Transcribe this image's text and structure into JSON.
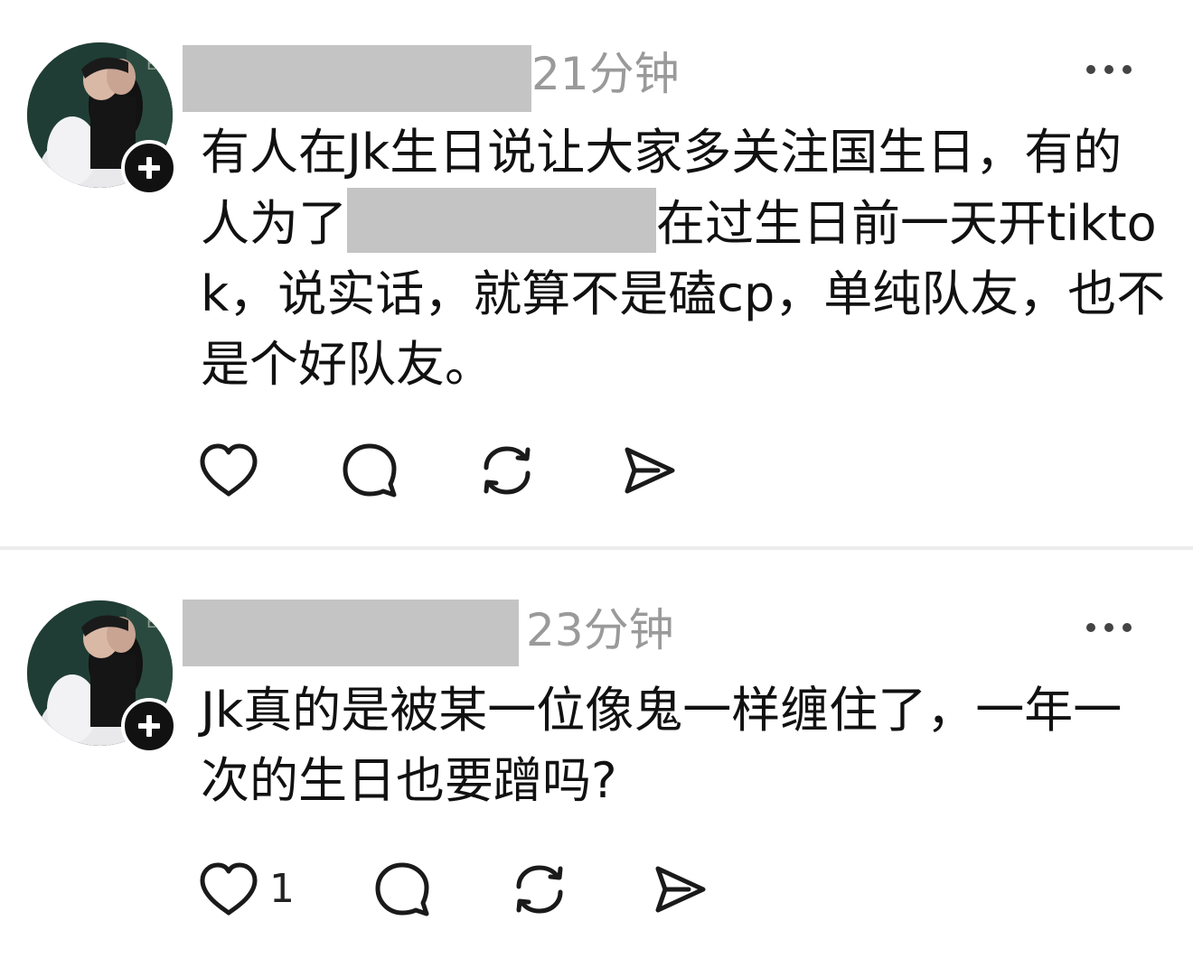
{
  "posts": [
    {
      "timestamp": "21分钟",
      "text_before_redaction": "有人在Jk生日说让大家多关注国生日，有的人为了",
      "text_after_redaction": "在过生日前一天开tiktok，说实话，就算不是磕cp，单纯队友，也不是个好队友。",
      "like_count": ""
    },
    {
      "timestamp": "23分钟",
      "text": "Jk真的是被某一位像鬼一样缠住了，一年一次的生日也要蹭吗?",
      "like_count": "1"
    }
  ],
  "icons": {
    "avatar": "avatar-photo",
    "follow": "plus-icon",
    "more": "more-dots-icon",
    "like": "heart-icon",
    "comment": "comment-bubble-icon",
    "repost": "repost-icon",
    "share": "send-icon"
  },
  "colors": {
    "text": "#111111",
    "timestamp": "#9a9a9a",
    "redaction": "#c4c4c4",
    "badge": "#111111",
    "divider": "#ececec"
  }
}
